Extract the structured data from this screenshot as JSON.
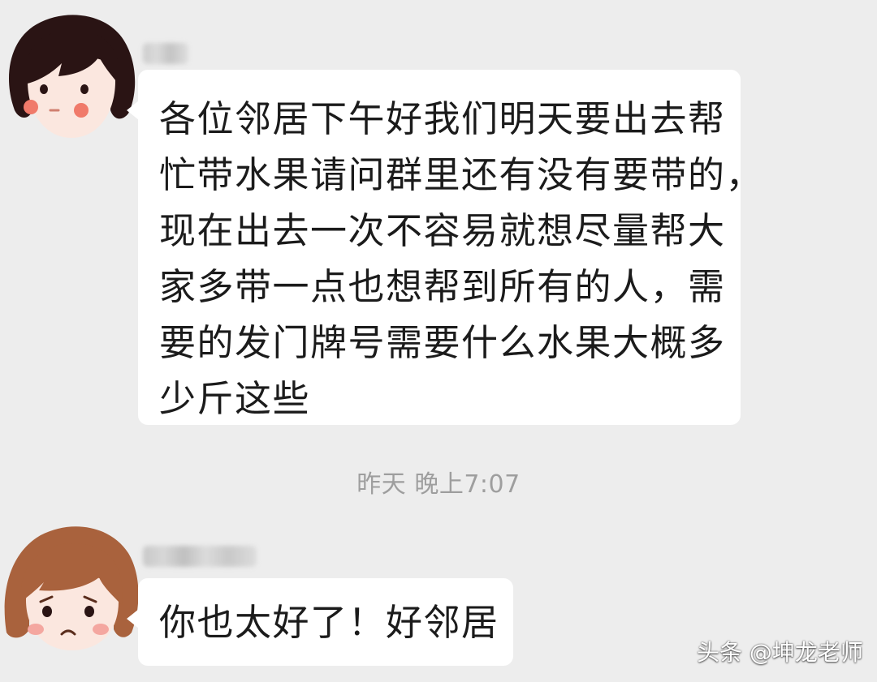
{
  "messages": [
    {
      "sender": "",
      "avatar": "girl-avatar-dark-hair",
      "lines": [
        "各位邻居下午好我们明天要出去帮",
        "忙带水果请问群里还有没有要带的，",
        "现在出去一次不容易就想尽量帮大",
        "家多带一点也想帮到所有的人，需",
        "要的发门牌号需要什么水果大概多",
        "少斤这些"
      ]
    },
    {
      "sender": "",
      "avatar": "girl-avatar-brown-hair-touched",
      "lines": [
        "你也太好了！好邻居"
      ]
    }
  ],
  "timestamp": "昨天 晚上7:07",
  "watermark": "头条 @坤龙老师",
  "colors": {
    "background": "#ededed",
    "bubble": "#ffffff",
    "text": "#1b1b1b",
    "timestamp": "#9e9e9e"
  }
}
